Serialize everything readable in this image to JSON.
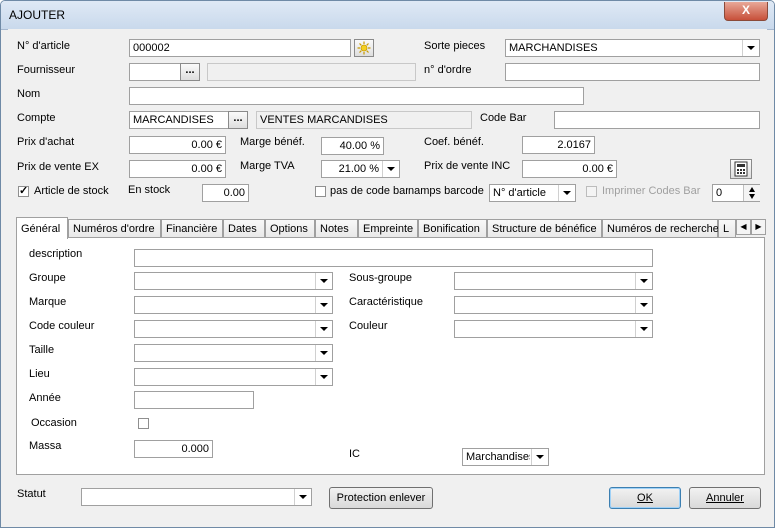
{
  "window": {
    "title": "AJOUTER",
    "close": "X"
  },
  "article": {
    "numero_label": "N° d'article",
    "numero_value": "000002",
    "fournisseur_label": "Fournisseur",
    "fournisseur_value": "",
    "nom_label": "Nom",
    "nom_value": "",
    "compte_label": "Compte",
    "compte_value": "MARCANDISES",
    "compte_desc": "VENTES MARCANDISES",
    "prix_achat_label": "Prix d'achat",
    "prix_achat_value": "0.00 €",
    "prix_vente_ex_label": "Prix de vente EX",
    "prix_vente_ex_value": "0.00 €",
    "marge_benef_label": "Marge bénéf.",
    "marge_benef_value": "40.00 %",
    "marge_tva_label": "Marge TVA",
    "marge_tva_value": "21.00 %",
    "sorte_label": "Sorte pieces",
    "sorte_value": "MARCHANDISES",
    "ordre_label": "n° d'ordre",
    "ordre_value": "",
    "codebar_label": "Code Bar",
    "codebar_value": "",
    "coef_label": "Coef. bénéf.",
    "coef_value": "2.0167",
    "prix_vente_inc_label": "Prix de vente INC",
    "prix_vente_inc_value": "0.00 €",
    "article_stock_label": "Article de stock",
    "en_stock_label": "En stock",
    "en_stock_value": "0.00",
    "pas_code_bar_label": "pas de code bar",
    "champs_barcode_label": "namps barcode",
    "champs_barcode_value": "N° d'article",
    "imprimer_label": "Imprimer Codes Bar",
    "copies_value": "0"
  },
  "tabs": [
    "Général",
    "Numéros d'ordre",
    "Financière",
    "Dates",
    "Options",
    "Notes",
    "Empreinte",
    "Bonification",
    "Structure de bénéfice",
    "Numéros de recherche",
    "L"
  ],
  "general": {
    "description_label": "description",
    "groupe_label": "Groupe",
    "marque_label": "Marque",
    "code_couleur_label": "Code couleur",
    "taille_label": "Taille",
    "lieu_label": "Lieu",
    "annee_label": "Année",
    "occasion_label": "Occasion",
    "massa_label": "Massa",
    "massa_value": "0.000",
    "sous_groupe_label": "Sous-groupe",
    "caracteristique_label": "Caractéristique",
    "couleur_label": "Couleur",
    "ic_label": "IC",
    "ic_value": "Marchandises"
  },
  "footer": {
    "statut_label": "Statut",
    "statut_value": "",
    "protection_label": "Protection enlever",
    "ok_label": "OK",
    "annuler_label": "Annuler"
  }
}
